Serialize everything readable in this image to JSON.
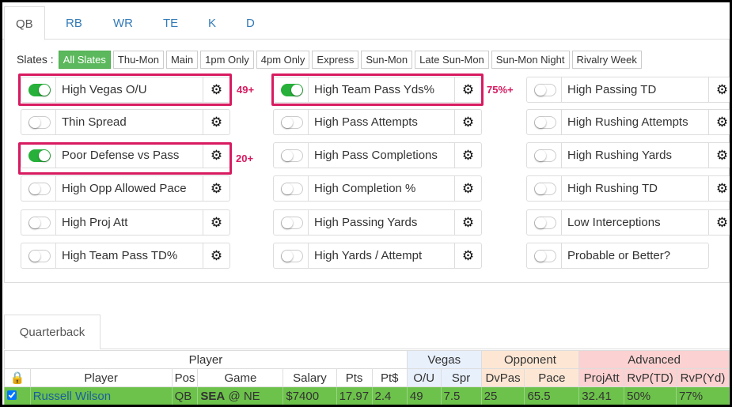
{
  "tabs": [
    "QB",
    "RB",
    "WR",
    "TE",
    "K",
    "D"
  ],
  "slates": {
    "label": "Slates :",
    "items": [
      "All Slates",
      "Thu-Mon",
      "Main",
      "1pm Only",
      "4pm Only",
      "Express",
      "Sun-Mon",
      "Late Sun-Mon",
      "Sun-Mon Night",
      "Rivalry Week"
    ],
    "active": "All Slates"
  },
  "filters": [
    [
      {
        "label": "High Vegas O/U",
        "on": true
      },
      {
        "label": "Thin Spread",
        "on": false
      },
      {
        "label": "Poor Defense vs Pass",
        "on": true
      },
      {
        "label": "High Opp Allowed Pace",
        "on": false
      },
      {
        "label": "High Proj Att",
        "on": false
      },
      {
        "label": "High Team Pass TD%",
        "on": false
      }
    ],
    [
      {
        "label": "High Team Pass Yds%",
        "on": true
      },
      {
        "label": "High Pass Attempts",
        "on": false
      },
      {
        "label": "High Pass Completions",
        "on": false
      },
      {
        "label": "High Completion %",
        "on": false
      },
      {
        "label": "High Passing Yards",
        "on": false
      },
      {
        "label": "High Yards / Attempt",
        "on": false
      }
    ],
    [
      {
        "label": "High Passing TD",
        "on": false
      },
      {
        "label": "High Rushing Attempts",
        "on": false
      },
      {
        "label": "High Rushing Yards",
        "on": false
      },
      {
        "label": "High Rushing TD",
        "on": false
      },
      {
        "label": "Low Interceptions",
        "on": false
      },
      {
        "label": "Probable or Better?",
        "on": false,
        "no_gear": true
      }
    ]
  ],
  "annotations": {
    "vegas": "49+",
    "pass_yds": "75%+",
    "defense": "20+"
  },
  "bottom_tab": "Quarterback",
  "table": {
    "groups": [
      "Player",
      "Vegas",
      "Opponent",
      "Advanced"
    ],
    "headers": [
      "Player",
      "Pos",
      "Game",
      "Salary",
      "Pts",
      "Pt$",
      "O/U",
      "Spr",
      "DvPas",
      "Pace",
      "ProjAtt",
      "RvP(TD)",
      "RvP(Yd)"
    ],
    "rows": [
      {
        "checked": true,
        "player": "Russell Wilson",
        "pos": "QB",
        "team": "SEA",
        "game_rest": "@ NE",
        "salary": "$7400",
        "pts": "17.97",
        "ptd": "2.4",
        "ou": "49",
        "spr": "7.5",
        "dvpas": "25",
        "pace": "65.5",
        "projatt": "32.41",
        "rvptd": "50%",
        "rvpyd": "77%"
      }
    ]
  },
  "colors": {
    "toggle_on": "#27b03a",
    "highlight": "#d81b60",
    "row_bg": "#6cc24a",
    "active_slate": "#5cb85c"
  }
}
